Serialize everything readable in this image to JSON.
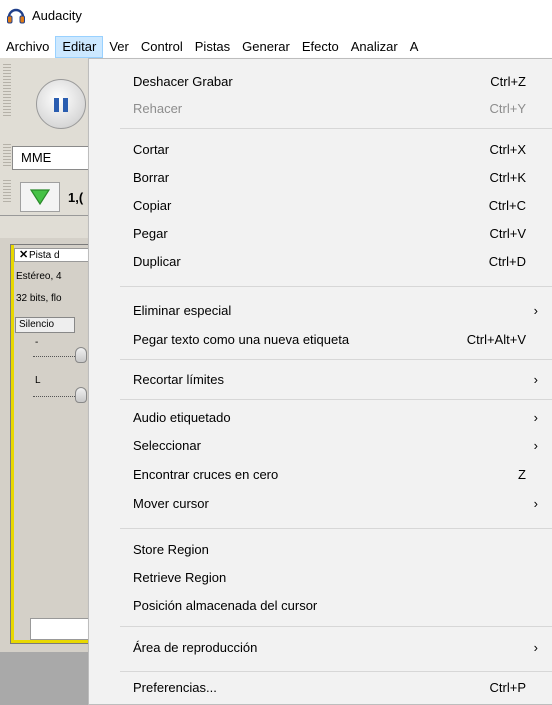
{
  "window": {
    "title": "Audacity"
  },
  "menubar": {
    "items": [
      {
        "label": "Archivo"
      },
      {
        "label": "Editar"
      },
      {
        "label": "Ver"
      },
      {
        "label": "Control"
      },
      {
        "label": "Pistas"
      },
      {
        "label": "Generar"
      },
      {
        "label": "Efecto"
      },
      {
        "label": "Analizar"
      },
      {
        "label": "A"
      }
    ],
    "active_index": 1
  },
  "toolbar": {
    "host": "MME",
    "meter_value": "1,("
  },
  "track": {
    "name": "Pista d",
    "info_line1": "Estéreo, 4",
    "info_line2": "32 bits, flo",
    "silence_label": "Silencio",
    "gain_label": "-",
    "pan_label": "L"
  },
  "edit_menu": {
    "items": [
      {
        "label": "Deshacer Grabar",
        "shortcut": "Ctrl+Z",
        "enabled": true,
        "submenu": false
      },
      {
        "label": "Rehacer",
        "shortcut": "Ctrl+Y",
        "enabled": false,
        "submenu": false
      },
      {
        "label": "Cortar",
        "shortcut": "Ctrl+X",
        "enabled": true,
        "submenu": false
      },
      {
        "label": "Borrar",
        "shortcut": "Ctrl+K",
        "enabled": true,
        "submenu": false
      },
      {
        "label": "Copiar",
        "shortcut": "Ctrl+C",
        "enabled": true,
        "submenu": false
      },
      {
        "label": "Pegar",
        "shortcut": "Ctrl+V",
        "enabled": true,
        "submenu": false
      },
      {
        "label": "Duplicar",
        "shortcut": "Ctrl+D",
        "enabled": true,
        "submenu": false
      },
      {
        "label": "Eliminar especial",
        "shortcut": "",
        "enabled": true,
        "submenu": true
      },
      {
        "label": "Pegar texto como una nueva etiqueta",
        "shortcut": "Ctrl+Alt+V",
        "enabled": true,
        "submenu": false
      },
      {
        "label": "Recortar límites",
        "shortcut": "",
        "enabled": true,
        "submenu": true
      },
      {
        "label": "Audio etiquetado",
        "shortcut": "",
        "enabled": true,
        "submenu": true
      },
      {
        "label": "Seleccionar",
        "shortcut": "",
        "enabled": true,
        "submenu": true
      },
      {
        "label": "Encontrar cruces en cero",
        "shortcut": "Z",
        "enabled": true,
        "submenu": false
      },
      {
        "label": "Mover cursor",
        "shortcut": "",
        "enabled": true,
        "submenu": true
      },
      {
        "label": "Store Region",
        "shortcut": "",
        "enabled": true,
        "submenu": false
      },
      {
        "label": "Retrieve Region",
        "shortcut": "",
        "enabled": true,
        "submenu": false
      },
      {
        "label": "Posición almacenada del cursor",
        "shortcut": "",
        "enabled": true,
        "submenu": false
      },
      {
        "label": "Área de reproducción",
        "shortcut": "",
        "enabled": true,
        "submenu": true
      },
      {
        "label": "Preferencias...",
        "shortcut": "Ctrl+P",
        "enabled": true,
        "submenu": false
      }
    ],
    "submenu_arrow": "›"
  },
  "colors": {
    "menu_bg": "#f2f2f2",
    "active_menu_bg": "#cce8ff",
    "disabled_text": "#8d8d8d",
    "track_selection": "#e8d800",
    "pause_icon": "#2a5db0",
    "play_icon": "#3aa83a"
  },
  "icons": {
    "app": "headphones-icon",
    "pause": "pause-icon",
    "play": "play-icon",
    "close": "close-icon",
    "submenu": "chevron-right-icon"
  }
}
